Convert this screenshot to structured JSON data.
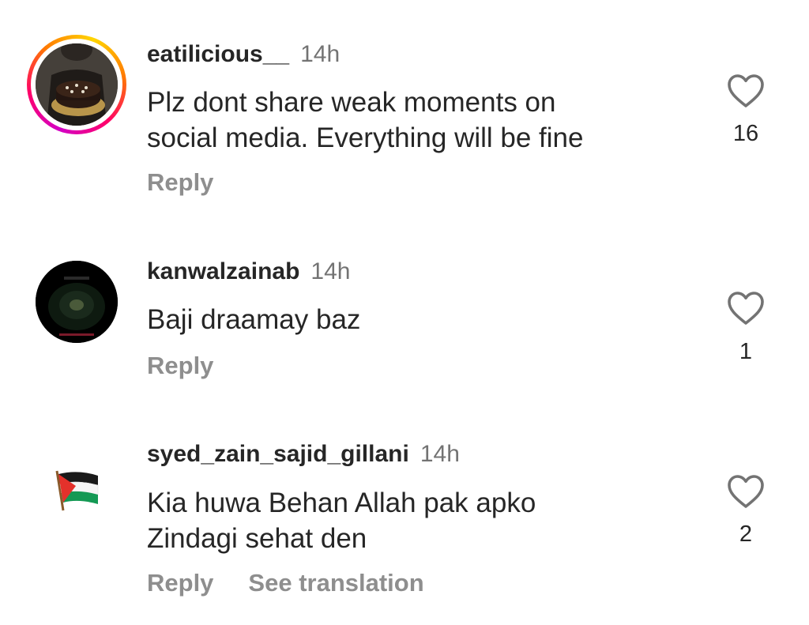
{
  "comments": [
    {
      "username": "eatilicious__",
      "time": "14h",
      "text_lines": [
        "Plz dont share weak moments on",
        "social media. Everything will be fine"
      ],
      "reply_label": "Reply",
      "likes": "16",
      "avatar_icon": "cake-photo-avatar",
      "has_story_ring": true
    },
    {
      "username": "kanwalzainab",
      "time": "14h",
      "text_lines": [
        "Baji draamay baz"
      ],
      "reply_label": "Reply",
      "likes": "1",
      "avatar_icon": "dark-photo-avatar"
    },
    {
      "username": "syed_zain_sajid_gillani",
      "time": "14h",
      "text_lines": [
        "Kia huwa Behan Allah pak apko",
        "Zindagi sehat den"
      ],
      "reply_label": "Reply",
      "see_translation_label": "See translation",
      "likes": "2",
      "avatar_icon": "palestine-flag-avatar"
    }
  ],
  "colors": {
    "text": "#262626",
    "secondary": "#737373",
    "action": "#8e8e8e",
    "palestine_red": "#e4312b",
    "palestine_green": "#149954"
  }
}
